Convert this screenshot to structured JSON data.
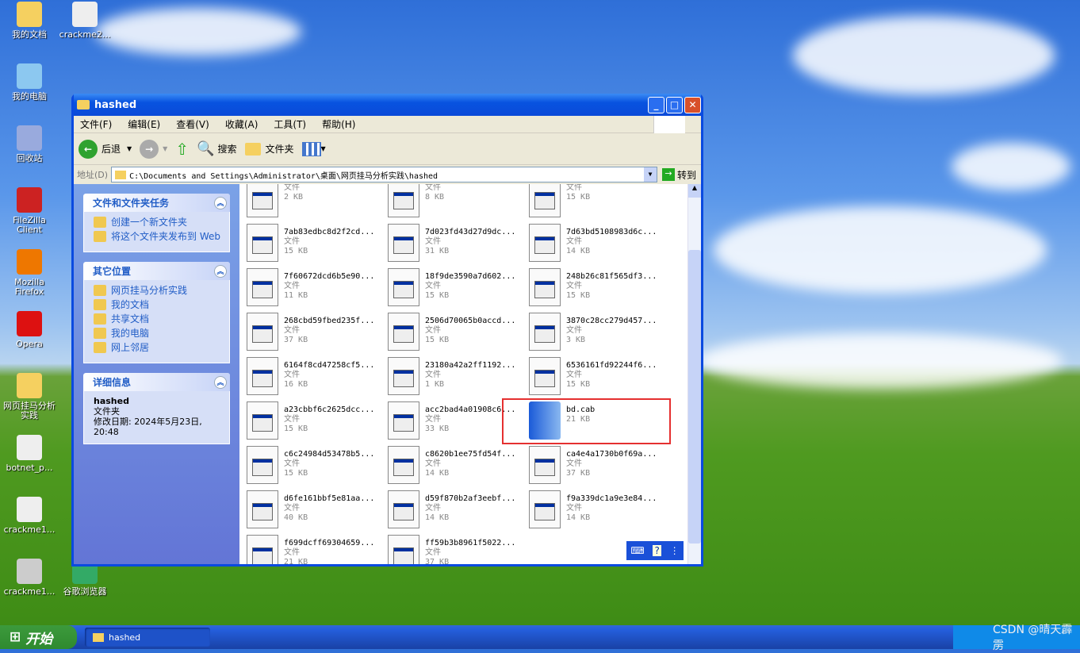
{
  "desktop": {
    "icons": [
      {
        "label": "我的文档",
        "col": 0,
        "row": 0
      },
      {
        "label": "我的电脑",
        "col": 0,
        "row": 1
      },
      {
        "label": "回收站",
        "col": 0,
        "row": 2
      },
      {
        "label": "FileZilla Client",
        "col": 0,
        "row": 3
      },
      {
        "label": "Mozilla Firefox",
        "col": 0,
        "row": 4
      },
      {
        "label": "Opera",
        "col": 0,
        "row": 5
      },
      {
        "label": "网页挂马分析实践",
        "col": 0,
        "row": 6
      },
      {
        "label": "botnet_p...",
        "col": 0,
        "row": 7
      },
      {
        "label": "crackme1...",
        "col": 0,
        "row": 8
      },
      {
        "label": "crackme1...",
        "col": 0,
        "row": 9
      },
      {
        "label": "crackme2...",
        "col": 1,
        "row": 0
      },
      {
        "label": "谷歌浏览器",
        "col": 1,
        "row": 9
      }
    ]
  },
  "window": {
    "title": "hashed",
    "menu": [
      "文件(F)",
      "编辑(E)",
      "查看(V)",
      "收藏(A)",
      "工具(T)",
      "帮助(H)"
    ],
    "toolbar": {
      "back": "后退",
      "search": "搜索",
      "folders": "文件夹"
    },
    "address": {
      "label": "地址(D)",
      "value": "C:\\Documents and Settings\\Administrator\\桌面\\网页挂马分析实践\\hashed",
      "go": "转到"
    },
    "tasks": {
      "title": "文件和文件夹任务",
      "items": [
        "创建一个新文件夹",
        "将这个文件夹发布到 Web"
      ]
    },
    "places": {
      "title": "其它位置",
      "items": [
        "网页挂马分析实践",
        "我的文档",
        "共享文档",
        "我的电脑",
        "网上邻居"
      ]
    },
    "details": {
      "title": "详细信息",
      "name": "hashed",
      "type": "文件夹",
      "modified": "修改日期: 2024年5月23日, 20:48"
    },
    "files": [
      {
        "name": "",
        "type": "文件",
        "size": "2 KB"
      },
      {
        "name": "",
        "type": "文件",
        "size": "8 KB"
      },
      {
        "name": "",
        "type": "文件",
        "size": "15 KB"
      },
      {
        "name": "7ab83edbc8d2f2cd...",
        "type": "文件",
        "size": "15 KB"
      },
      {
        "name": "7d023fd43d27d9dc...",
        "type": "文件",
        "size": "31 KB"
      },
      {
        "name": "7d63bd5108983d6c...",
        "type": "文件",
        "size": "14 KB"
      },
      {
        "name": "7f60672dcd6b5e90...",
        "type": "文件",
        "size": "11 KB"
      },
      {
        "name": "18f9de3590a7d602...",
        "type": "文件",
        "size": "15 KB"
      },
      {
        "name": "248b26c81f565df3...",
        "type": "文件",
        "size": "15 KB"
      },
      {
        "name": "268cbd59fbed235f...",
        "type": "文件",
        "size": "37 KB"
      },
      {
        "name": "2506d70065b0accd...",
        "type": "文件",
        "size": "15 KB"
      },
      {
        "name": "3870c28cc279d457...",
        "type": "文件",
        "size": "3 KB"
      },
      {
        "name": "6164f8cd47258cf5...",
        "type": "文件",
        "size": "16 KB"
      },
      {
        "name": "23180a42a2ff1192...",
        "type": "文件",
        "size": "1 KB"
      },
      {
        "name": "6536161fd92244f6...",
        "type": "文件",
        "size": "15 KB"
      },
      {
        "name": "a23cbbf6c2625dcc...",
        "type": "文件",
        "size": "15 KB"
      },
      {
        "name": "acc2bad4a01908c6...",
        "type": "文件",
        "size": "33 KB"
      },
      {
        "name": "bd.cab",
        "type": "",
        "size": "21 KB",
        "highlighted": true
      },
      {
        "name": "c6c24984d53478b5...",
        "type": "文件",
        "size": "15 KB"
      },
      {
        "name": "c8620b1ee75fd54f...",
        "type": "文件",
        "size": "14 KB"
      },
      {
        "name": "ca4e4a1730b0f69a...",
        "type": "文件",
        "size": "37 KB"
      },
      {
        "name": "d6fe161bbf5e81aa...",
        "type": "文件",
        "size": "40 KB"
      },
      {
        "name": "d59f870b2af3eebf...",
        "type": "文件",
        "size": "14 KB"
      },
      {
        "name": "f9a339dc1a9e3e84...",
        "type": "文件",
        "size": "14 KB"
      },
      {
        "name": "f699dcff69304659...",
        "type": "文件",
        "size": "21 KB"
      },
      {
        "name": "ff59b3b8961f5022...",
        "type": "文件",
        "size": "37 KB"
      }
    ],
    "highlight_color": "#e53030"
  },
  "taskbar": {
    "start": "开始",
    "task": "hashed",
    "watermark": "CSDN @晴天霹雳"
  }
}
